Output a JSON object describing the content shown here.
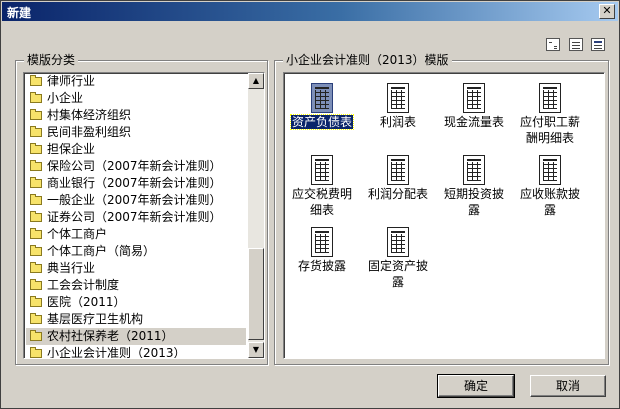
{
  "window": {
    "title": "新建",
    "close_label": "✕"
  },
  "categories": {
    "label": "模版分类",
    "selected_index": 15,
    "items": [
      "律师行业",
      "小企业",
      "村集体经济组织",
      "民间非盈利组织",
      "担保企业",
      "保险公司（2007年新会计准则）",
      "商业银行（2007年新会计准则）",
      "一般企业（2007年新会计准则）",
      "证券公司（2007年新会计准则）",
      "个体工商户",
      "个体工商户（简易）",
      "典当行业",
      "工会会计制度",
      "医院（2011）",
      "基层医疗卫生机构",
      "农村社保养老（2011）",
      "小企业会计准则（2013）"
    ]
  },
  "templates": {
    "label": "小企业会计准则（2013）模版",
    "selected_index": 0,
    "items": [
      [
        "资产负债表"
      ],
      [
        "利润表"
      ],
      [
        "现金流量表"
      ],
      [
        "应付职工薪",
        "酬明细表"
      ],
      [
        "应交税费明",
        "细表"
      ],
      [
        "利润分配表"
      ],
      [
        "短期投资披",
        "露"
      ],
      [
        "应收账款披",
        "露"
      ],
      [
        "存货披露"
      ],
      [
        "固定资产披",
        "露"
      ]
    ]
  },
  "buttons": {
    "ok_label": "确定",
    "cancel_label": "取消"
  }
}
